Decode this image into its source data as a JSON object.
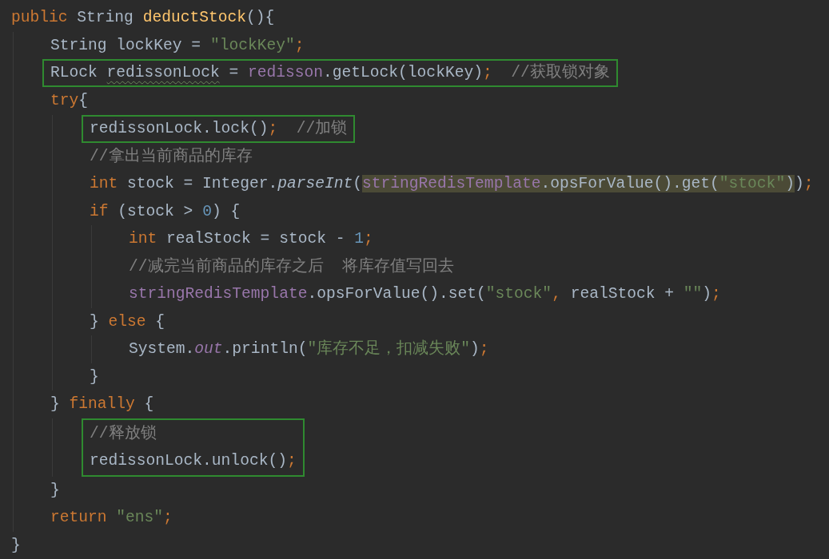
{
  "editor": {
    "code": [
      {
        "kind": "line",
        "tokens": [
          {
            "text": "public",
            "kind": "keyword"
          },
          {
            "text": " String ",
            "kind": "plain"
          },
          {
            "text": "deductStock",
            "kind": "declaration"
          },
          {
            "text": "(){",
            "kind": "plain"
          }
        ],
        "children": [
          {
            "kind": "line",
            "tokens": [
              {
                "text": "String lockKey = ",
                "kind": "plain"
              },
              {
                "text": "\"lockKey\"",
                "kind": "string"
              },
              {
                "text": ";",
                "kind": "keyword"
              }
            ]
          },
          {
            "kind": "box",
            "lines": [
              {
                "kind": "line",
                "tokens": [
                  {
                    "text": "RLock ",
                    "kind": "plain"
                  },
                  {
                    "text": "redissonLock",
                    "kind": "plain",
                    "warning": true
                  },
                  {
                    "text": " = ",
                    "kind": "plain"
                  },
                  {
                    "text": "redisson",
                    "kind": "field"
                  },
                  {
                    "text": ".getLock(lockKey)",
                    "kind": "plain"
                  },
                  {
                    "text": ";",
                    "kind": "keyword"
                  },
                  {
                    "text": "  //获取锁对象",
                    "kind": "comment"
                  }
                ]
              }
            ]
          },
          {
            "kind": "line",
            "tokens": [
              {
                "text": "try",
                "kind": "keyword"
              },
              {
                "text": "{",
                "kind": "plain"
              }
            ],
            "children": [
              {
                "kind": "box",
                "lines": [
                  {
                    "kind": "line",
                    "tokens": [
                      {
                        "text": "redissonLock.lock()",
                        "kind": "plain"
                      },
                      {
                        "text": ";",
                        "kind": "keyword"
                      },
                      {
                        "text": "  //加锁",
                        "kind": "comment"
                      }
                    ]
                  }
                ]
              },
              {
                "kind": "line",
                "tokens": [
                  {
                    "text": "//拿出当前商品的库存",
                    "kind": "comment"
                  }
                ]
              },
              {
                "kind": "line",
                "tokens": [
                  {
                    "text": "int",
                    "kind": "keyword"
                  },
                  {
                    "text": " stock = Integer.",
                    "kind": "plain"
                  },
                  {
                    "text": "parseInt",
                    "kind": "static-method"
                  },
                  {
                    "text": "(",
                    "kind": "plain"
                  },
                  {
                    "text": "stringRedisTemplate",
                    "kind": "field",
                    "marked": true
                  },
                  {
                    "text": ".opsForValue().get(",
                    "kind": "plain",
                    "marked": true
                  },
                  {
                    "text": "\"stock\"",
                    "kind": "string",
                    "marked": true
                  },
                  {
                    "text": ")",
                    "kind": "plain",
                    "marked": true
                  },
                  {
                    "text": ")",
                    "kind": "plain"
                  },
                  {
                    "text": ";",
                    "kind": "keyword"
                  }
                ]
              },
              {
                "kind": "line",
                "tokens": [
                  {
                    "text": "if",
                    "kind": "keyword"
                  },
                  {
                    "text": " (stock > ",
                    "kind": "plain"
                  },
                  {
                    "text": "0",
                    "kind": "number"
                  },
                  {
                    "text": ") {",
                    "kind": "plain"
                  }
                ],
                "children": [
                  {
                    "kind": "line",
                    "tokens": [
                      {
                        "text": "int",
                        "kind": "keyword"
                      },
                      {
                        "text": " realStock = stock - ",
                        "kind": "plain"
                      },
                      {
                        "text": "1",
                        "kind": "number"
                      },
                      {
                        "text": ";",
                        "kind": "keyword"
                      }
                    ]
                  },
                  {
                    "kind": "line",
                    "tokens": [
                      {
                        "text": "//减完当前商品的库存之后  将库存值写回去",
                        "kind": "comment"
                      }
                    ]
                  },
                  {
                    "kind": "line",
                    "tokens": [
                      {
                        "text": "stringRedisTemplate",
                        "kind": "field"
                      },
                      {
                        "text": ".opsForValue().set(",
                        "kind": "plain"
                      },
                      {
                        "text": "\"stock\"",
                        "kind": "string"
                      },
                      {
                        "text": ", ",
                        "kind": "keyword"
                      },
                      {
                        "text": "realStock + ",
                        "kind": "plain"
                      },
                      {
                        "text": "\"\"",
                        "kind": "string"
                      },
                      {
                        "text": ")",
                        "kind": "plain"
                      },
                      {
                        "text": ";",
                        "kind": "keyword"
                      }
                    ]
                  }
                ]
              },
              {
                "kind": "line",
                "tokens": [
                  {
                    "text": "} ",
                    "kind": "plain"
                  },
                  {
                    "text": "else",
                    "kind": "keyword"
                  },
                  {
                    "text": " {",
                    "kind": "plain"
                  }
                ],
                "children": [
                  {
                    "kind": "line",
                    "tokens": [
                      {
                        "text": "System.",
                        "kind": "plain"
                      },
                      {
                        "text": "out",
                        "kind": "static-field"
                      },
                      {
                        "text": ".println(",
                        "kind": "plain"
                      },
                      {
                        "text": "\"库存不足，扣减失败\"",
                        "kind": "string"
                      },
                      {
                        "text": ")",
                        "kind": "plain"
                      },
                      {
                        "text": ";",
                        "kind": "keyword"
                      }
                    ]
                  }
                ]
              },
              {
                "kind": "line",
                "tokens": [
                  {
                    "text": "}",
                    "kind": "plain"
                  }
                ]
              }
            ]
          },
          {
            "kind": "line",
            "tokens": [
              {
                "text": "} ",
                "kind": "plain"
              },
              {
                "text": "finally",
                "kind": "keyword"
              },
              {
                "text": " {",
                "kind": "plain"
              }
            ],
            "children": [
              {
                "kind": "box",
                "lines": [
                  {
                    "kind": "line",
                    "tokens": [
                      {
                        "text": "//释放锁",
                        "kind": "comment"
                      }
                    ]
                  },
                  {
                    "kind": "line",
                    "tokens": [
                      {
                        "text": "redissonLock.unlock()",
                        "kind": "plain"
                      },
                      {
                        "text": ";",
                        "kind": "keyword"
                      }
                    ]
                  }
                ]
              }
            ]
          },
          {
            "kind": "line",
            "tokens": [
              {
                "text": "}",
                "kind": "plain"
              }
            ]
          },
          {
            "kind": "line",
            "tokens": [
              {
                "text": "return ",
                "kind": "keyword"
              },
              {
                "text": "\"ens\"",
                "kind": "string"
              },
              {
                "text": ";",
                "kind": "keyword"
              }
            ]
          }
        ]
      },
      {
        "kind": "line",
        "tokens": [
          {
            "text": "}",
            "kind": "plain"
          }
        ]
      }
    ]
  }
}
